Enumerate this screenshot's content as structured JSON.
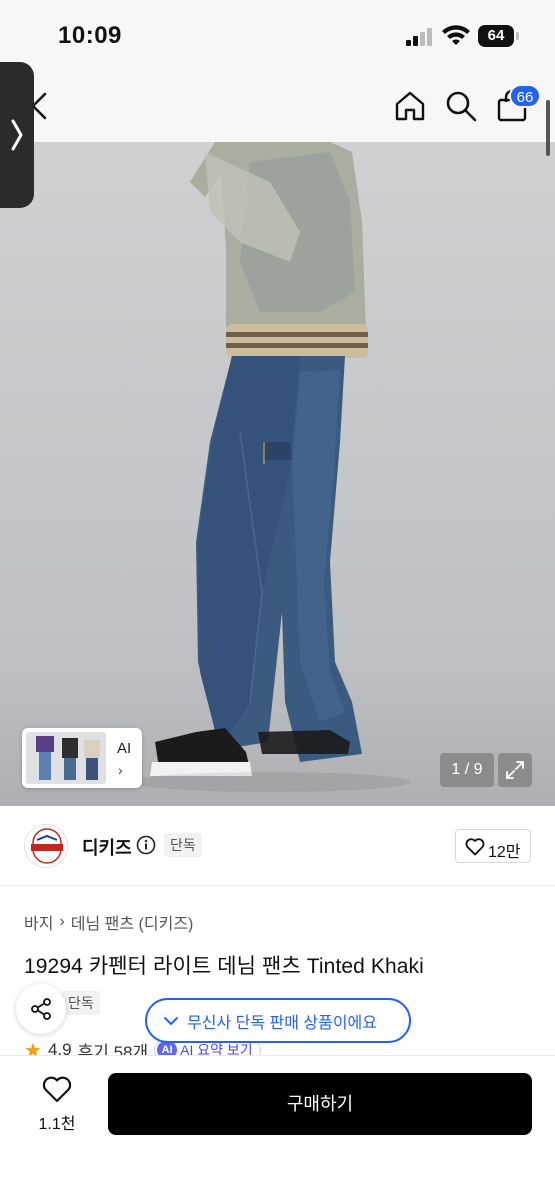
{
  "status_bar": {
    "time": "10:09",
    "battery": "64"
  },
  "nav": {
    "cart_count": "66",
    "icons": [
      "back-icon",
      "home-icon",
      "search-icon",
      "bag-icon"
    ]
  },
  "gallery": {
    "thumb_label": "AI",
    "page_indicator": "1 / 9"
  },
  "brand": {
    "name": "디키즈",
    "exclusive_label": "단독",
    "likes": "12만"
  },
  "product": {
    "breadcrumb": [
      "바지",
      "데님 팬츠 (디키즈)"
    ],
    "title": "19294 카펜터 라이트 데님 팬츠 Tinted Khaki",
    "exclusive_label": "단독",
    "rating": "4.9",
    "reviews": "후기 58개",
    "ai_summary": "AI 요약 보기"
  },
  "toast": {
    "message": "무신사 단독 판매 상품이에요"
  },
  "bottom_bar": {
    "wishlist_count": "1.1천",
    "buy_label": "구매하기"
  },
  "colors": {
    "accent_blue": "#2563eb",
    "buy_button": "#000000",
    "star": "#f59e0b"
  }
}
